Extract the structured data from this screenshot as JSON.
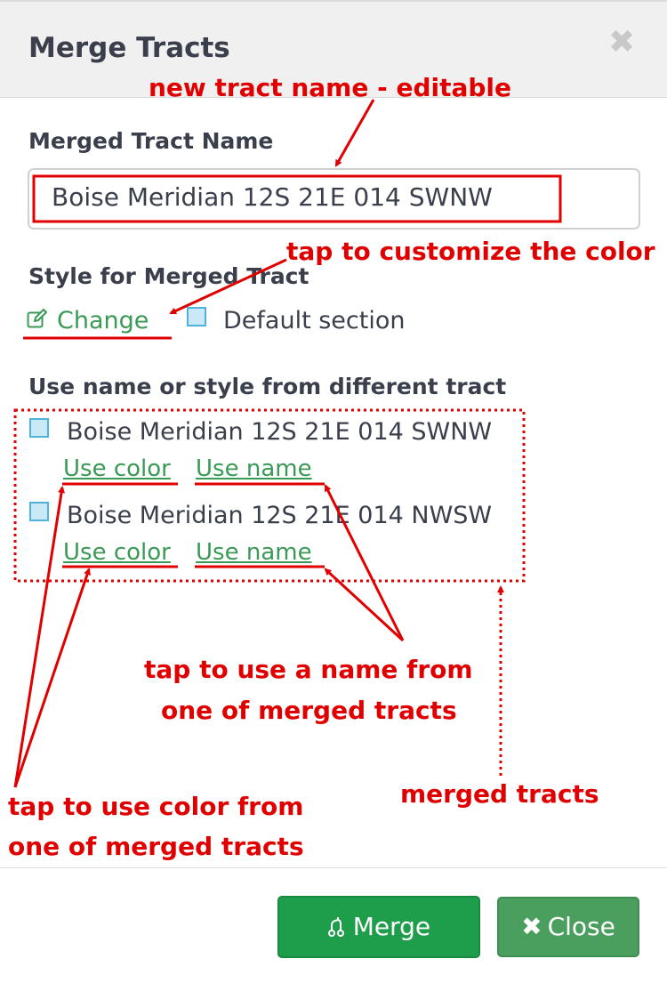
{
  "dialog": {
    "title": "Merge Tracts",
    "close_icon": "close-icon"
  },
  "merged_name": {
    "label": "Merged Tract Name",
    "value": "Boise Meridian 12S 21E 014 SWNW"
  },
  "style": {
    "label": "Style for Merged Tract",
    "change_label": "Change",
    "change_icon": "edit-icon",
    "swatch_color": "#c9e9f6",
    "default_label": "Default section"
  },
  "tracts": {
    "label": "Use name or style from different tract",
    "items": [
      {
        "name": "Boise Meridian 12S 21E 014 SWNW",
        "use_color": "Use color",
        "use_name": "Use name"
      },
      {
        "name": "Boise Meridian 12S 21E 014 NWSW",
        "use_color": "Use color",
        "use_name": "Use name"
      }
    ]
  },
  "footer": {
    "merge_label": "Merge",
    "merge_icon": "merge-icon",
    "close_label": "Close",
    "close_icon": "close-icon"
  },
  "annotations": {
    "new_name": "new tract name - editable",
    "customize": "tap to customize the color",
    "use_name_1": "tap to use a name from",
    "use_name_2": "one of merged tracts",
    "use_color_1": "tap to use color from",
    "use_color_2": "one of merged tracts",
    "merged": "merged tracts"
  },
  "colors": {
    "accent_green": "#3a9a55",
    "annotation_red": "#e00000",
    "merge_button": "#1e9e4a",
    "close_button": "#4a9f5f"
  }
}
